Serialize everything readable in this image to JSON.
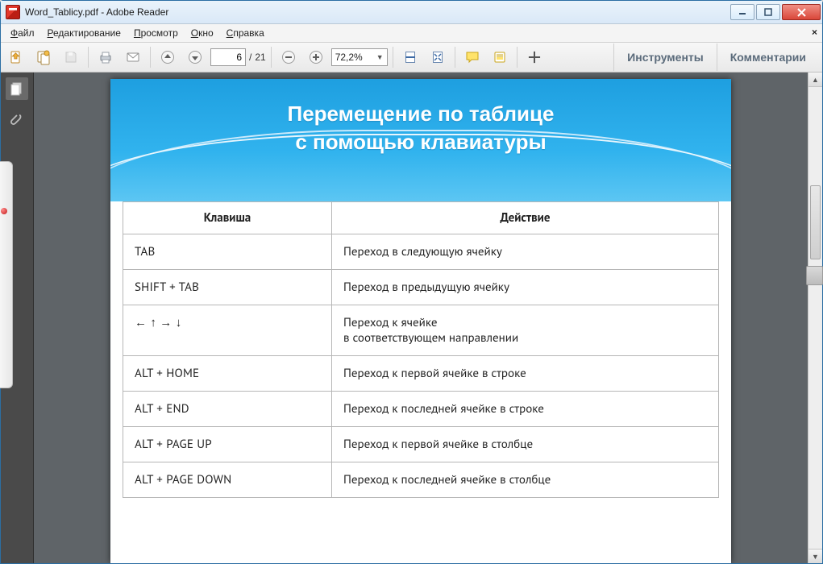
{
  "window": {
    "title": "Word_Tablicy.pdf - Adobe Reader"
  },
  "menu": {
    "file": {
      "label": "Файл",
      "u": "Ф"
    },
    "edit": {
      "label": "Редактирование",
      "u": "Р"
    },
    "view": {
      "label": "Просмотр",
      "u": "П"
    },
    "window": {
      "label": "Окно",
      "u": "О"
    },
    "help": {
      "label": "Справка",
      "u": "С"
    }
  },
  "toolbar": {
    "page_current": "6",
    "page_sep": "/",
    "page_total": "21",
    "zoom_value": "72,2%",
    "tools_label": "Инструменты",
    "comments_label": "Комментарии"
  },
  "document": {
    "heading_line1": "Перемещение по таблице",
    "heading_line2": "с помощью клавиатуры",
    "col1": "Клавиша",
    "col2": "Действие",
    "rows": [
      {
        "k": "TAB",
        "a": "Переход в следующую ячейку"
      },
      {
        "k": "SHIFT + TAB",
        "a": "Переход в предыдущую ячейку"
      },
      {
        "k": "← ↑ → ↓",
        "a": "Переход к ячейке\nв соответствующем направлении"
      },
      {
        "k": "ALT + HOME",
        "a": "Переход к первой ячейке в строке"
      },
      {
        "k": "ALT + END",
        "a": "Переход к последней ячейке  в строке"
      },
      {
        "k": "ALT + PAGE UP",
        "a": "Переход к первой ячейке в столбце"
      },
      {
        "k": "ALT + PAGE DOWN",
        "a": "Переход к последней ячейке  в столбце"
      }
    ]
  }
}
